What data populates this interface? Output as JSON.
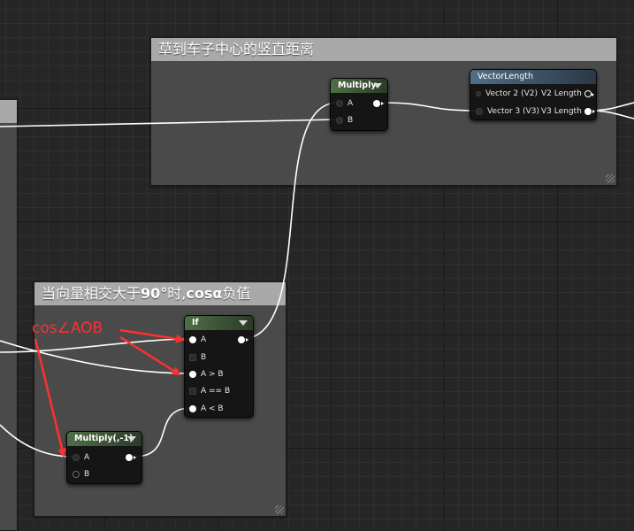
{
  "comments": {
    "top": {
      "title": "草到车子中心的竖直距离"
    },
    "bottom": {
      "title_pre": "当向量相交大于",
      "title_bold": "90°",
      "title_mid": "时,",
      "title_bold2": "cosα",
      "title_post": "负值"
    }
  },
  "nodes": {
    "multiply": {
      "title": "Multiply",
      "pin_a": "A",
      "pin_b": "B"
    },
    "vector_length": {
      "title": "VectorLength",
      "in_v2": "Vector 2 (V2)",
      "in_v3": "Vector 3 (V3)",
      "out_v2": "V2 Length",
      "out_v3": "V3 Length"
    },
    "if_node": {
      "title": "If",
      "pin_a": "A",
      "pin_b": "B",
      "pin_a_gt_b": "A > B",
      "pin_a_eq_b": "A == B",
      "pin_a_lt_b": "A < B"
    },
    "multiply_neg": {
      "title": "Multiply(,-1)",
      "pin_a": "A",
      "pin_b": "B"
    }
  },
  "annotation": {
    "label": "cos∠AOB",
    "color": "#ff3030"
  },
  "colors": {
    "wire": "#ffffff",
    "arrow": "#ff3030",
    "comment_header": "#a9a9a9",
    "math_header": "#4e6e45",
    "vector_header": "#4f6f88"
  }
}
